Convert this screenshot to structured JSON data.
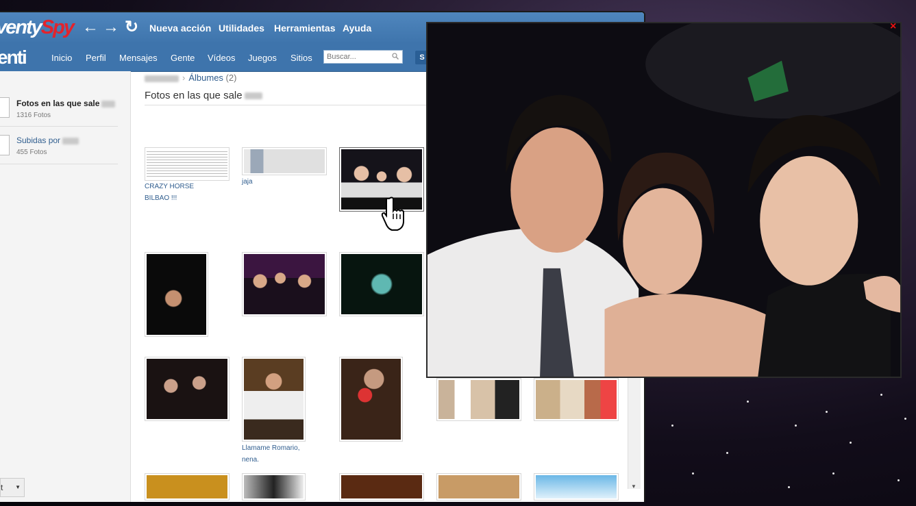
{
  "topbar": {
    "logo_prefix": "venty",
    "logo_suffix": "Spy",
    "menu": [
      "Nueva acción",
      "Utilidades",
      "Herramientas",
      "Ayuda"
    ]
  },
  "navbar": {
    "brand": "enti",
    "links": [
      "Inicio",
      "Perfil",
      "Mensajes",
      "Gente",
      "Vídeos",
      "Juegos",
      "Sitios"
    ],
    "search_placeholder": "Buscar...",
    "button_label": "S"
  },
  "sidebar": {
    "items": [
      {
        "title": "Fotos en las que sale",
        "count": "1316 Fotos"
      },
      {
        "title": "Subidas por",
        "count": "455 Fotos"
      }
    ],
    "dropdown": "t"
  },
  "main": {
    "breadcrumb_album": "Álbumes",
    "breadcrumb_count": "(2)",
    "title": "Fotos en las que sale",
    "captions": {
      "c1a": "CRAZY HORSE",
      "c1b": "BILBAO !!!",
      "c2": "jaja",
      "c3a": "Llamame Romario,",
      "c3b": "nena."
    }
  },
  "viewer": {
    "close": "×"
  },
  "colors": {
    "brand_blue": "#3e74ac",
    "logo_red": "#e3232c",
    "link": "#2f5d8e"
  }
}
